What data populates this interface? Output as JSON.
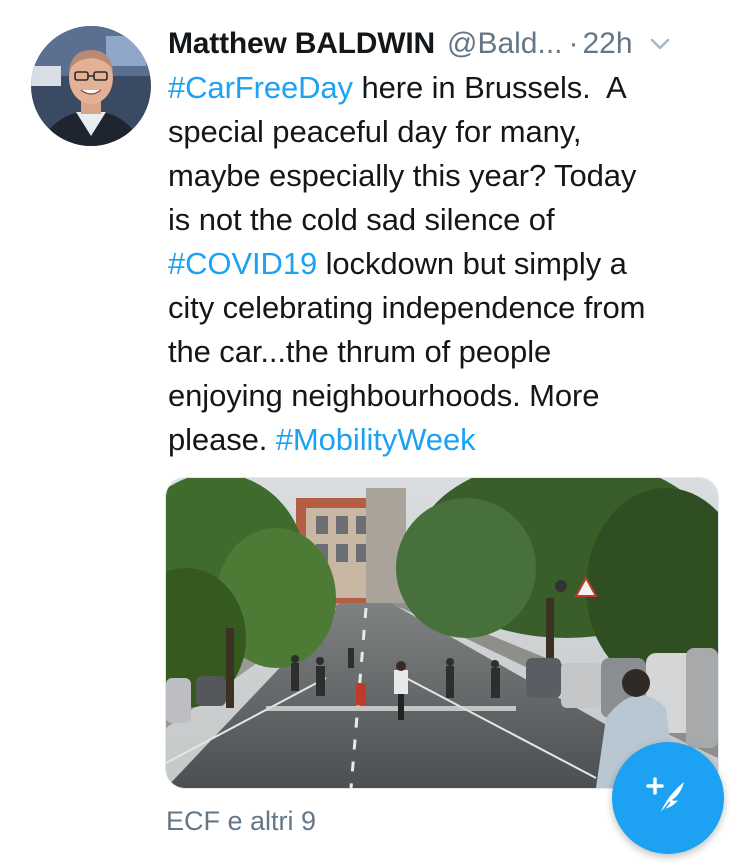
{
  "tweet": {
    "author_name": "Matthew BALDWIN",
    "author_handle": "@Bald...",
    "separator": "·",
    "timestamp": "22h",
    "text_lines": [
      [
        {
          "text": "#CarFreeDay",
          "hashtag": true
        },
        {
          "text": " here in Brussels.  A",
          "hashtag": false
        }
      ],
      [
        {
          "text": "special peaceful day for many,",
          "hashtag": false
        }
      ],
      [
        {
          "text": "maybe especially this year? Today",
          "hashtag": false
        }
      ],
      [
        {
          "text": "is not the cold sad silence of",
          "hashtag": false
        }
      ],
      [
        {
          "text": "#COVID19",
          "hashtag": true
        },
        {
          "text": " lockdown but simply a",
          "hashtag": false
        }
      ],
      [
        {
          "text": "city celebrating independence from",
          "hashtag": false
        }
      ],
      [
        {
          "text": "the car...the thrum of people",
          "hashtag": false
        }
      ],
      [
        {
          "text": "enjoying neighbourhoods. More",
          "hashtag": false
        }
      ],
      [
        {
          "text": "please. ",
          "hashtag": false
        },
        {
          "text": "#MobilityWeek",
          "hashtag": true
        }
      ]
    ],
    "liked_by": "ECF e altri 9"
  },
  "icons": {
    "menu": "chevron-down-icon",
    "compose": "compose-tweet-icon"
  },
  "colors": {
    "link": "#1da1f2",
    "secondary_text": "#657786",
    "primary_text": "#14171a",
    "fab": "#1da1f2"
  }
}
